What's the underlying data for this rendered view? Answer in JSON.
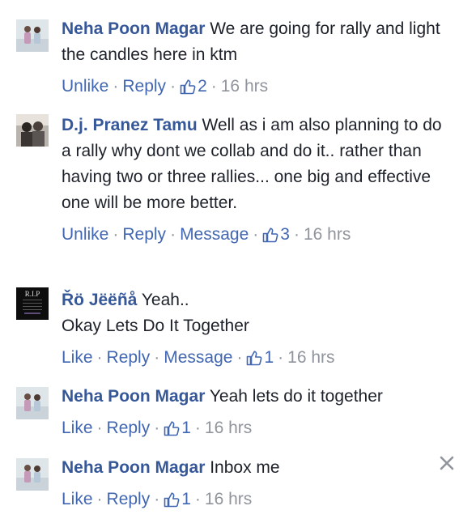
{
  "comments": [
    {
      "author": "Neha Poon Magar",
      "text": "We are going for rally and light the candles here in ktm",
      "actions": {
        "like": "Unlike",
        "reply": "Reply",
        "likes": "2",
        "time": "16 hrs"
      }
    },
    {
      "author": "D.j. Pranez Tamu",
      "text": "Well as i am also planning to do a rally why dont we collab and do it.. rather than having two or three rallies... one big and effective one will be more better.",
      "actions": {
        "like": "Unlike",
        "reply": "Reply",
        "message": "Message",
        "likes": "3",
        "time": "16 hrs"
      }
    },
    {
      "author": "Řö Jëëñå",
      "text": "Yeah..",
      "text2": "Okay Lets Do It Together",
      "avatar_text": "R.I.P",
      "actions": {
        "like": "Like",
        "reply": "Reply",
        "message": "Message",
        "likes": "1",
        "time": "16 hrs"
      }
    },
    {
      "author": "Neha Poon Magar",
      "text": "Yeah lets do it together",
      "actions": {
        "like": "Like",
        "reply": "Reply",
        "likes": "1",
        "time": "16 hrs"
      }
    },
    {
      "author": "Neha Poon Magar",
      "text": "Inbox me",
      "actions": {
        "like": "Like",
        "reply": "Reply",
        "likes": "1",
        "time": "16 hrs"
      }
    }
  ],
  "separator": "·",
  "icons": {
    "like": "thumbs-up-icon",
    "close": "close-icon"
  },
  "colors": {
    "link": "#4267b2",
    "author": "#365899",
    "meta": "#90949c"
  }
}
